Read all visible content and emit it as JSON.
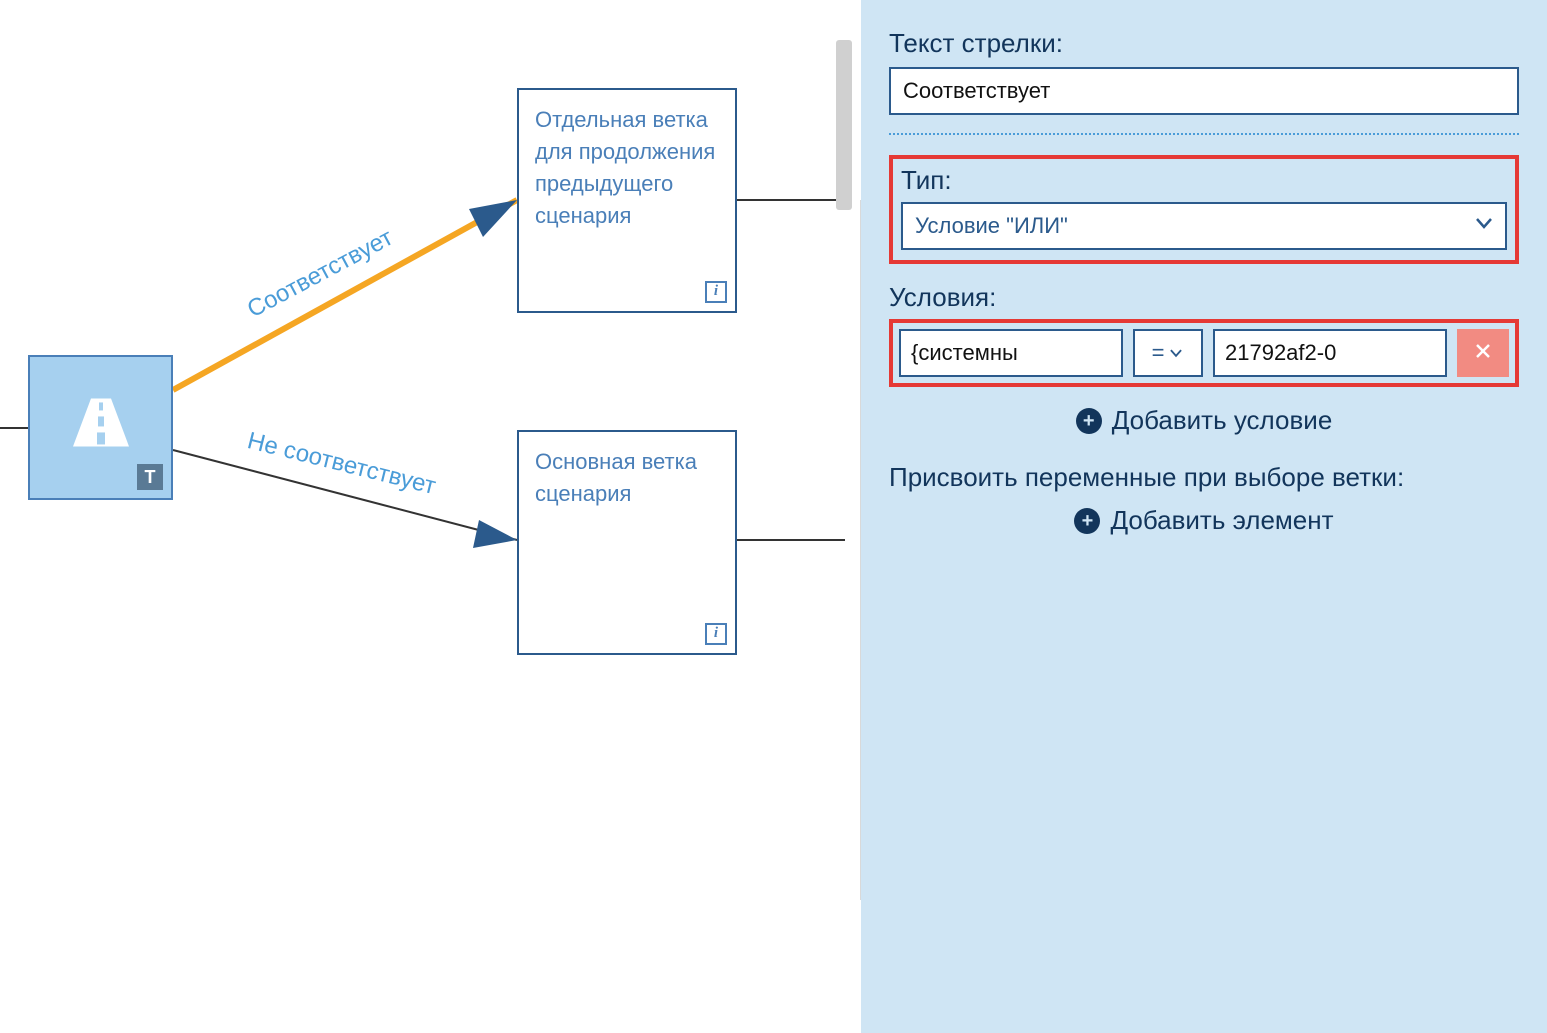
{
  "canvas": {
    "start_badge": "T",
    "edge1_label": "Соответствует",
    "edge2_label": "Не соответствует",
    "box1_text": "Отдельная ветка для продолжения предыдущего сценария",
    "box2_text": "Основная ветка сценария",
    "info_glyph": "i"
  },
  "panel": {
    "arrow_text_label": "Текст стрелки:",
    "arrow_text_value": "Соответствует",
    "type_label": "Тип:",
    "type_value": "Условие \"ИЛИ\"",
    "conditions_label": "Условия:",
    "cond_left": "{системны",
    "cond_op": "=",
    "cond_right": "21792af2-0",
    "add_condition": "Добавить условие",
    "assign_vars_label": "Присвоить переменные при выборе ветки:",
    "add_element": "Добавить элемент"
  }
}
